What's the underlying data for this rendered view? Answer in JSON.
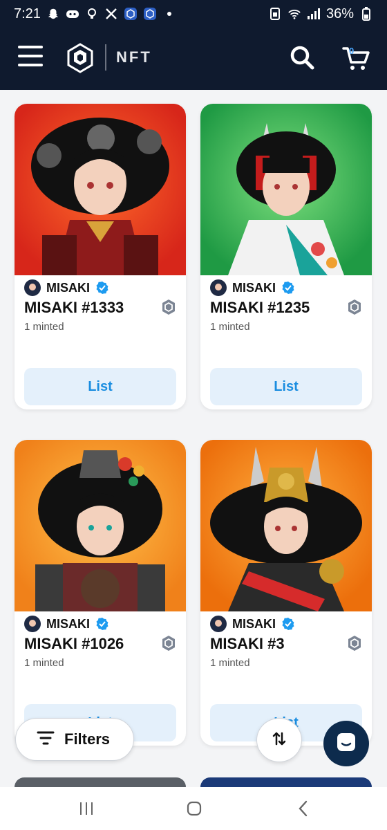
{
  "status_bar": {
    "time": "7:21",
    "battery": "36%",
    "left_icons": [
      "snapchat-icon",
      "discord-icon",
      "vpn-icon",
      "x-icon",
      "cronos-icon",
      "cronos-icon",
      "dot-icon"
    ],
    "right_icons": [
      "sim-icon",
      "wifi-icon",
      "signal-icon",
      "battery-icon"
    ]
  },
  "header": {
    "brand": "NFT",
    "cart_count": "0",
    "bg_color": "#0f1a2e"
  },
  "cards": [
    {
      "collection": "MISAKI",
      "title": "MISAKI #1333",
      "minted": "1 minted",
      "button": "List",
      "art_bg": "#e8371f",
      "art": "samurai-girl-skulls-red"
    },
    {
      "collection": "MISAKI",
      "title": "MISAKI #1235",
      "minted": "1 minted",
      "button": "List",
      "art_bg": "#2fa84f",
      "art": "samurai-girl-horns-green"
    },
    {
      "collection": "MISAKI",
      "title": "MISAKI #1026",
      "minted": "1 minted",
      "button": "List",
      "art_bg": "#f28a1a",
      "art": "samurai-girl-oni-mask-orange"
    },
    {
      "collection": "MISAKI",
      "title": "MISAKI #3",
      "minted": "1 minted",
      "button": "List",
      "art_bg": "#f07a0e",
      "art": "samurai-girl-horned-helmet-orange"
    }
  ],
  "controls": {
    "filters_label": "Filters",
    "sort_icon": "sort-arrows-icon",
    "chat_icon": "chat-icon"
  },
  "colors": {
    "accent": "#1a8de0",
    "list_button_bg": "#e4f0fb",
    "verified": "#1d9bf0"
  }
}
